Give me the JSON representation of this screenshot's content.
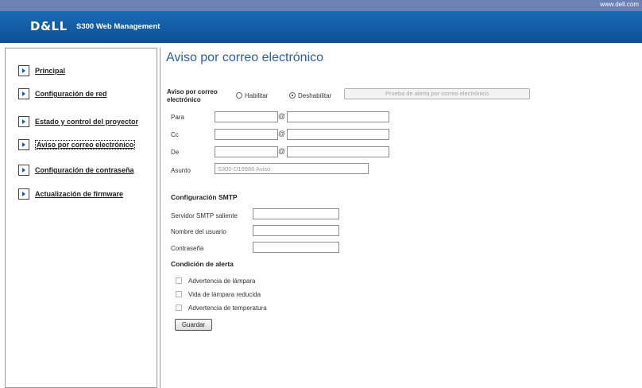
{
  "topbar": {
    "url": "www.dell.com"
  },
  "header": {
    "logo": "D&LL",
    "product": "S300 Web Management"
  },
  "sidebar": {
    "items": [
      {
        "label": "Principal"
      },
      {
        "label": "Configuración de red"
      },
      {
        "label": "Estado y control del proyector"
      },
      {
        "label": "Aviso por correo electrónico",
        "active": true
      },
      {
        "label": "Configuración de contraseña"
      },
      {
        "label": "Actualización de firmware"
      }
    ]
  },
  "page": {
    "title": "Aviso por correo electrónico"
  },
  "alert": {
    "label_line1": "Aviso por correo",
    "label_line2": "electrónico",
    "enable_label": "Habilitar",
    "disable_label": "Deshabilitar",
    "selected": "Deshabilitar",
    "test_button": "Prueba de alerta por correo electrónico"
  },
  "fields": {
    "to_label": "Para",
    "cc_label": "Cc",
    "from_label": "De",
    "at_symbol": "@",
    "subject_label": "Asunto",
    "subject_value": "S300-D19986  Aviso"
  },
  "smtp": {
    "heading": "Configuración SMTP",
    "server_label": "Servidor SMTP saliente",
    "user_label": "Nombre del usuario",
    "password_label": "Contraseña"
  },
  "conditions": {
    "heading": "Condición de alerta",
    "items": [
      {
        "label": "Advertencia de lámpara",
        "checked": false
      },
      {
        "label": "Vida de lámpara reducida",
        "checked": false
      },
      {
        "label": "Advertencia de temperatura",
        "checked": false
      }
    ]
  },
  "save_button": "Guardar",
  "colors": {
    "header": "#0d4f95",
    "topbar": "#6d82b4",
    "title": "#2b5da9"
  }
}
